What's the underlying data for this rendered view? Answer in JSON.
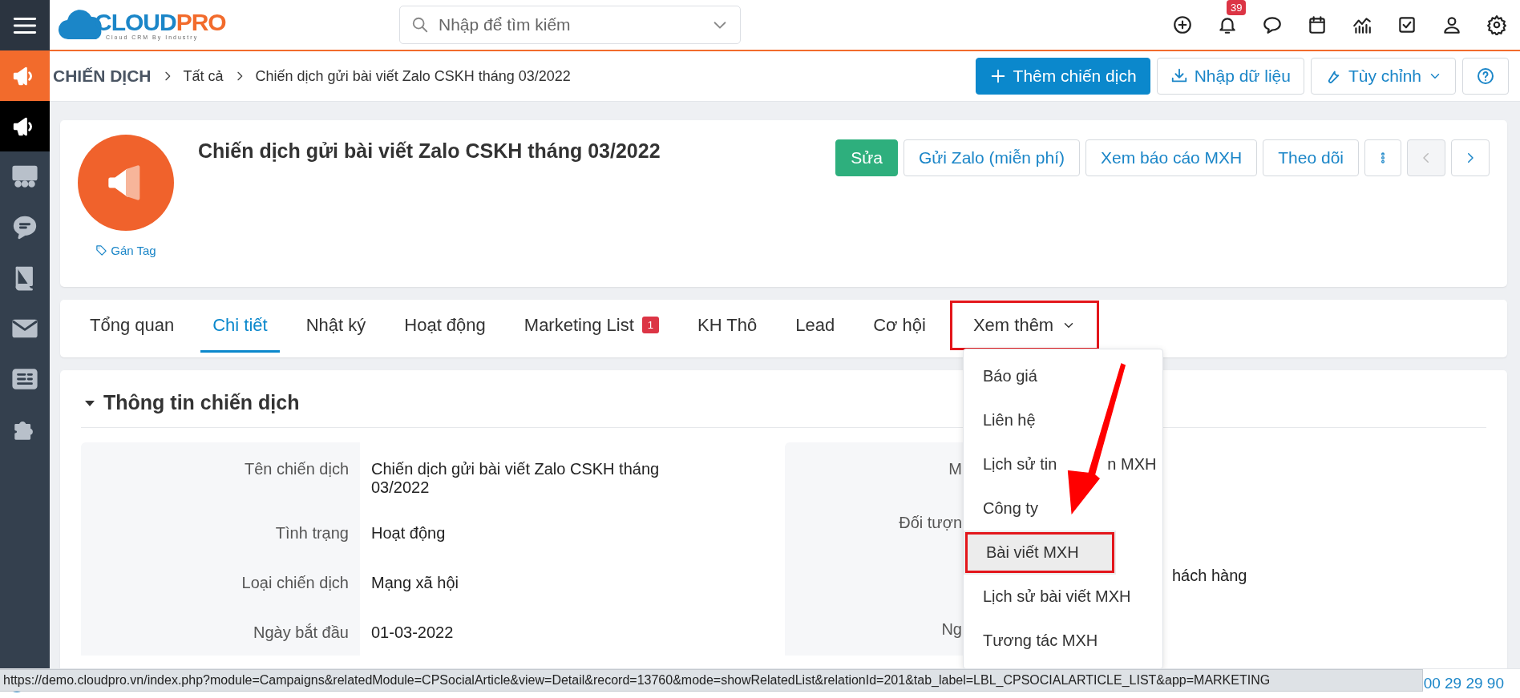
{
  "topbar": {
    "logo": {
      "name": "CLOUD",
      "accent": "PRO",
      "tagline": "Cloud CRM By Industry"
    },
    "search": {
      "placeholder": "Nhập để tìm kiếm"
    },
    "notification_count": "39"
  },
  "sidebar": {
    "items": [
      {
        "kind": "megaphone",
        "selected": false,
        "current_app": true
      },
      {
        "kind": "megaphone",
        "selected": true
      },
      {
        "kind": "presentation",
        "selected": false
      },
      {
        "kind": "chat",
        "selected": false
      },
      {
        "kind": "book",
        "selected": false
      },
      {
        "kind": "mail",
        "selected": false
      },
      {
        "kind": "fax",
        "selected": false
      },
      {
        "kind": "puzzle",
        "selected": false
      }
    ]
  },
  "breadcrumb": {
    "module": "CHIẾN DỊCH",
    "items": [
      "Tất cả",
      "Chiến dịch gửi bài viết Zalo CSKH tháng 03/2022"
    ]
  },
  "actions": [
    {
      "kind": "primary",
      "label": "Thêm chiến dịch"
    },
    {
      "kind": "import",
      "label": "Nhập dữ liệu"
    },
    {
      "kind": "dropdown",
      "label": "Tùy chỉnh"
    },
    {
      "kind": "help"
    }
  ],
  "record": {
    "title": "Chiến dịch gửi bài viết Zalo CSKH tháng 03/2022",
    "tag_link": "Gán Tag"
  },
  "record_buttons": [
    {
      "kind": "success",
      "label": "Sửa"
    },
    {
      "kind": "outline",
      "label": "Gửi Zalo (miễn phí)"
    },
    {
      "kind": "outline",
      "label": "Xem báo cáo MXH"
    },
    {
      "kind": "outline",
      "label": "Theo dõi"
    },
    {
      "kind": "more"
    },
    {
      "kind": "prev",
      "disabled": true
    },
    {
      "kind": "next",
      "disabled": false
    }
  ],
  "tabs": [
    {
      "label": "Tổng quan",
      "selected": false
    },
    {
      "label": "Chi tiết",
      "selected": true
    },
    {
      "label": "Nhật ký",
      "selected": false
    },
    {
      "label": "Hoạt động",
      "selected": false
    },
    {
      "label": "Marketing List",
      "badge": "1",
      "selected": false
    },
    {
      "label": "KH Thô",
      "selected": false
    },
    {
      "label": "Lead",
      "selected": false
    },
    {
      "label": "Cơ hội",
      "selected": false
    },
    {
      "label": "Xem thêm",
      "kind": "more",
      "selected": false,
      "highlighted": true
    }
  ],
  "dropdown": {
    "items": [
      {
        "label": "Báo giá",
        "hovered": false,
        "highlighted": false
      },
      {
        "label": "Liên hệ",
        "hovered": false,
        "highlighted": false
      },
      {
        "label": "Lịch sử tin",
        "label_tail": "n MXH",
        "hovered": false,
        "highlighted": false
      },
      {
        "label": "Công ty",
        "hovered": false,
        "highlighted": false
      },
      {
        "label": "Bài viết MXH",
        "hovered": true,
        "highlighted": true
      },
      {
        "label": "Lịch sử bài viết MXH",
        "hovered": false,
        "highlighted": false
      },
      {
        "label": "Tương tác MXH",
        "hovered": false,
        "highlighted": false
      }
    ]
  },
  "section": {
    "title": "Thông tin chiến dịch",
    "expanded": true,
    "left_fields": [
      {
        "label": "Tên chiến dịch",
        "value": "Chiến dịch gửi bài viết Zalo CSKH tháng 03/2022"
      },
      {
        "label": "Tình trạng",
        "value": "Hoạt động"
      },
      {
        "label": "Loại chiến dịch",
        "value": "Mạng xã hội"
      },
      {
        "label": "Ngày bắt đầu",
        "value": "01-03-2022"
      }
    ],
    "right_fields": [
      {
        "label": "M"
      },
      {
        "label": "Đối tượn"
      },
      {
        "value": "hách hàng"
      },
      {
        "label": "Ng"
      }
    ]
  },
  "footer": {
    "phone": "00 29 29 90"
  },
  "status_url": "https://demo.cloudpro.vn/index.php?module=Campaigns&relatedModule=CPSocialArticle&view=Detail&record=13760&mode=showRelatedList&relationId=201&tab_label=LBL_CPSOCIALARTICLE_LIST&app=MARKETING"
}
